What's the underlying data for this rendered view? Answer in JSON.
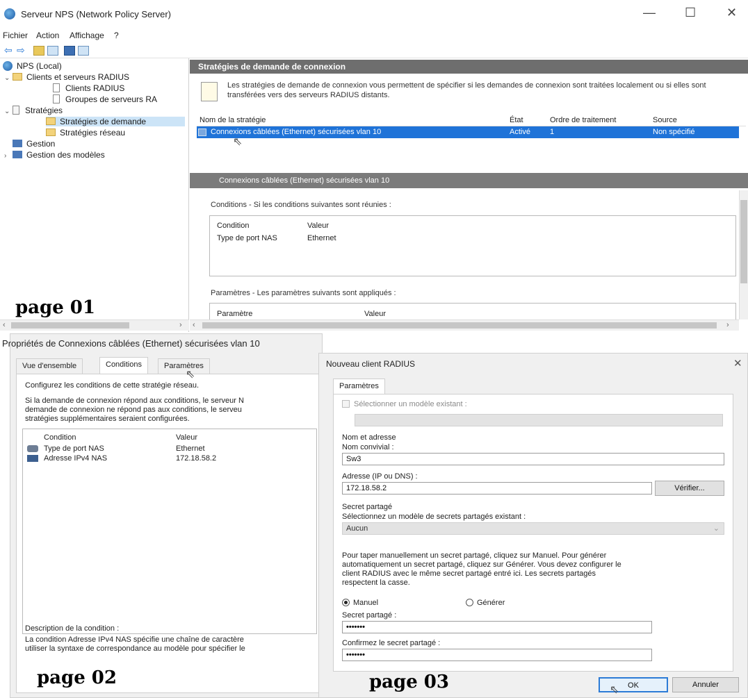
{
  "window": {
    "title": "Serveur NPS (Network Policy Server)",
    "menu": [
      "Fichier",
      "Action",
      "Affichage",
      "?"
    ]
  },
  "tree": {
    "items": [
      {
        "label": "NPS (Local)"
      },
      {
        "label": "Clients et serveurs RADIUS"
      },
      {
        "label": "Clients RADIUS"
      },
      {
        "label": "Groupes de serveurs RA"
      },
      {
        "label": "Stratégies"
      },
      {
        "label": "Stratégies de demande"
      },
      {
        "label": "Stratégies réseau"
      },
      {
        "label": "Gestion"
      },
      {
        "label": "Gestion des modèles"
      }
    ]
  },
  "main": {
    "header": "Stratégies de demande de connexion",
    "description": "Les stratégies de demande de connexion vous permettent de spécifier si les demandes de connexion sont traitées localement ou si elles sont transférées vers des serveurs RADIUS distants.",
    "columns": [
      "Nom de la stratégie",
      "État",
      "Ordre de traitement",
      "Source"
    ],
    "row": {
      "name": "Connexions câblées (Ethernet) sécurisées vlan 10",
      "state": "Activé",
      "order": "1",
      "source": "Non spécifié"
    },
    "detail_header": "Connexions câblées (Ethernet) sécurisées vlan 10",
    "conditions_label": "Conditions - Si les conditions suivantes sont réunies :",
    "conditions_cols": [
      "Condition",
      "Valeur"
    ],
    "conditions_row": {
      "condition": "Type de port NAS",
      "value": "Ethernet"
    },
    "params_label": "Paramètres - Les paramètres suivants sont appliqués :",
    "params_cols": [
      "Paramètre",
      "Valeur"
    ]
  },
  "watermarks": {
    "p1": "page 01",
    "p2": "page 02",
    "p3": "page 03"
  },
  "dialog2": {
    "title": "Propriétés de Connexions câblées (Ethernet) sécurisées vlan 10",
    "tabs": [
      "Vue d'ensemble",
      "Conditions",
      "Paramètres"
    ],
    "intro": "Configurez les conditions de cette stratégie réseau.",
    "para1": "Si la demande de connexion répond aux conditions, le serveur N",
    "para2": "demande de connexion ne répond pas aux conditions, le serveu",
    "para3": "stratégies supplémentaires seraient configurées.",
    "cols": [
      "Condition",
      "Valeur"
    ],
    "rows": [
      {
        "condition": "Type de port NAS",
        "value": "Ethernet"
      },
      {
        "condition": "Adresse IPv4 NAS",
        "value": "172.18.58.2"
      }
    ],
    "desc_label": "Description de la condition :",
    "desc1": "La condition Adresse IPv4 NAS spécifie une chaîne de caractère",
    "desc2": "utiliser la syntaxe de correspondance au modèle pour spécifier le"
  },
  "dialog3": {
    "title": "Nouveau client RADIUS",
    "tab": "Paramètres",
    "template_check": "Sélectionner un modèle existant :",
    "group_name": "Nom et adresse",
    "friendly_label": "Nom convivial :",
    "friendly_value": "Sw3",
    "address_label": "Adresse (IP ou DNS) :",
    "address_value": "172.18.58.2",
    "verify_button": "Vérifier...",
    "secret_group": "Secret partagé",
    "secret_template_label": "Sélectionnez un modèle de secrets partagés existant :",
    "secret_template_value": "Aucun",
    "help1": "Pour taper manuellement un secret partagé, cliquez sur Manuel. Pour générer",
    "help2": "automatiquement un secret partagé, cliquez sur Générer. Vous devez configurer le",
    "help3": "client RADIUS avec le même secret partagé entré ici. Les secrets partagés",
    "help4": "respectent la casse.",
    "radio_manual": "Manuel",
    "radio_generate": "Générer",
    "secret_label": "Secret partagé :",
    "secret_value": "•••••••",
    "confirm_label": "Confirmez le secret partagé :",
    "confirm_value": "•••••••",
    "ok": "OK",
    "cancel": "Annuler"
  }
}
